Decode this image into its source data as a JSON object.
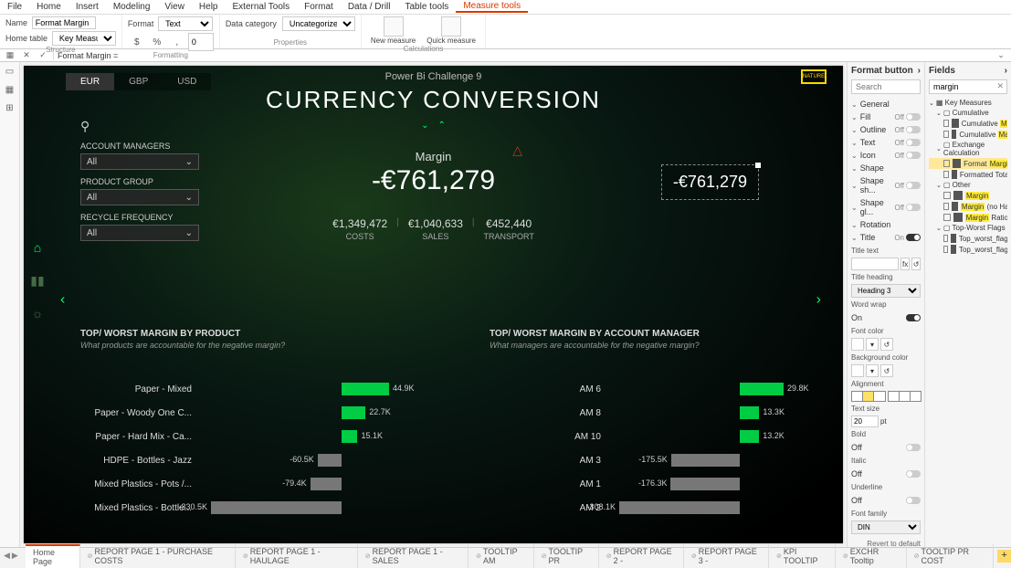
{
  "menu": {
    "items": [
      "File",
      "Home",
      "Insert",
      "Modeling",
      "View",
      "Help",
      "External Tools",
      "Format",
      "Data / Drill",
      "Table tools",
      "Measure tools"
    ],
    "active": 10
  },
  "ribbon": {
    "name_label": "Name",
    "name_value": "Format Margin",
    "home_table_label": "Home table",
    "home_table_value": "Key Measures",
    "structure": "Structure",
    "format_label": "Format",
    "format_value": "Text",
    "currency": "$",
    "percent": "%",
    "comma": ",",
    "decimals": "0",
    "formatting": "Formatting",
    "data_cat_label": "Data category",
    "data_cat_value": "Uncategorized",
    "properties": "Properties",
    "new_measure": "New\nmeasure",
    "quick_measure": "Quick\nmeasure",
    "calculations": "Calculations"
  },
  "fx": {
    "text": "Format Margin ="
  },
  "report": {
    "title_small": "Power Bi Challenge 9",
    "title": "CURRENCY CONVERSION",
    "currencies": [
      "EUR",
      "GBP",
      "USD"
    ],
    "currency_active": 0,
    "brand": "NATURE",
    "filters": {
      "account_managers": {
        "label": "ACCOUNT MANAGERS",
        "value": "All"
      },
      "product_group": {
        "label": "PRODUCT GROUP",
        "value": "All"
      },
      "recycle_frequency": {
        "label": "RECYCLE FREQUENCY",
        "value": "All"
      }
    },
    "metric": {
      "label": "Margin",
      "value": "-€761,279"
    },
    "card": {
      "value": "-€761,279"
    },
    "subs": [
      {
        "value": "€1,349,472",
        "label": "COSTS"
      },
      {
        "value": "€1,040,633",
        "label": "SALES"
      },
      {
        "value": "€452,440",
        "label": "TRANSPORT"
      }
    ],
    "sec_prod": {
      "title": "TOP/ WORST MARGIN BY PRODUCT",
      "sub": "What products are accountable for the negative margin?"
    },
    "sec_mgr": {
      "title": "TOP/ WORST MARGIN BY ACCOUNT MANAGER",
      "sub": "What managers are accountable for the negative margin?"
    }
  },
  "chart_data": [
    {
      "type": "bar",
      "orientation": "horizontal",
      "title": "TOP/ WORST MARGIN BY PRODUCT",
      "categories": [
        "Paper - Mixed",
        "Paper - Woody One C...",
        "Paper - Hard Mix - Ca...",
        "HDPE - Bottles - Jazz",
        "Mixed Plastics - Pots /...",
        "Mixed Plastics - Bottle..."
      ],
      "values": [
        44900,
        22700,
        15100,
        -60500,
        -79400,
        -330500
      ],
      "value_labels": [
        "44.9K",
        "22.7K",
        "15.1K",
        "-60.5K",
        "-79.4K",
        "-330.5K"
      ]
    },
    {
      "type": "bar",
      "orientation": "horizontal",
      "title": "TOP/ WORST MARGIN BY ACCOUNT MANAGER",
      "categories": [
        "AM 6",
        "AM 8",
        "AM 10",
        "AM 3",
        "AM 1",
        "AM 2"
      ],
      "values": [
        29800,
        13300,
        13200,
        -175500,
        -176300,
        -308100
      ],
      "value_labels": [
        "29.8K",
        "13.3K",
        "13.2K",
        "-175.5K",
        "-176.3K",
        "-308.1K"
      ]
    }
  ],
  "format_pane": {
    "title": "Format button",
    "search_ph": "Search",
    "rows": [
      {
        "name": "General"
      },
      {
        "name": "Fill",
        "state": "Off"
      },
      {
        "name": "Outline",
        "state": "Off"
      },
      {
        "name": "Text",
        "state": "Off"
      },
      {
        "name": "Icon",
        "state": "Off"
      },
      {
        "name": "Shape"
      },
      {
        "name": "Shape sh...",
        "state": "Off"
      },
      {
        "name": "Shape gl...",
        "state": "Off"
      },
      {
        "name": "Rotation"
      },
      {
        "name": "Title",
        "state": "On"
      }
    ],
    "title_text": "Title text",
    "title_text_hint": "fx",
    "title_heading": "Title heading",
    "title_heading_value": "Heading 3",
    "word_wrap": "Word wrap",
    "word_wrap_state": "On",
    "font_color": "Font color",
    "bg_color": "Background color",
    "alignment": "Alignment",
    "text_size": "Text size",
    "text_size_value": "20",
    "text_size_unit": "pt",
    "bold": "Bold",
    "bold_state": "Off",
    "italic": "Italic",
    "italic_state": "Off",
    "underline": "Underline",
    "underline_state": "Off",
    "font_family": "Font family",
    "font_family_value": "DIN",
    "revert": "Revert to default"
  },
  "fields_pane": {
    "title": "Fields",
    "search_value": "margin",
    "tables": [
      {
        "name": "Key Measures",
        "items": [
          {
            "group": "Cumulative",
            "items": [
              {
                "name": "Cumulative",
                "hl": "Margin"
              },
              {
                "name": "Cumulative",
                "hl": "Margin",
                "suffix": " Ratio"
              }
            ]
          },
          {
            "group": "Exchange Calculation",
            "items": [
              {
                "name": "Format",
                "hl": "Margin",
                "sel": true
              },
              {
                "name": "Formatted Total",
                "hl": "Margin"
              }
            ]
          },
          {
            "group": "Other",
            "items": [
              {
                "name": "",
                "hl": "Margin"
              },
              {
                "name": "",
                "hl": "Margin",
                "suffix": " (no Haulage)"
              },
              {
                "name": "",
                "hl": "Margin",
                "suffix": " Ratio"
              }
            ]
          },
          {
            "group": "Top-Worst Flags",
            "items": [
              {
                "name": "Top_worst_flag AM",
                "hl": "Margin"
              },
              {
                "name": "Top_worst_flag Product",
                "hl": "M"
              }
            ]
          }
        ]
      }
    ]
  },
  "page_tabs": {
    "tabs": [
      {
        "name": "Home Page",
        "hidden": false,
        "active": true
      },
      {
        "name": "REPORT PAGE 1 - PURCHASE COSTS",
        "hidden": true
      },
      {
        "name": "REPORT PAGE 1 - HAULAGE",
        "hidden": true
      },
      {
        "name": "REPORT PAGE 1 - SALES",
        "hidden": true
      },
      {
        "name": "TOOLTIP AM",
        "hidden": true
      },
      {
        "name": "TOOLTIP PR",
        "hidden": true
      },
      {
        "name": "REPORT PAGE 2 -",
        "hidden": true
      },
      {
        "name": "REPORT PAGE 3 -",
        "hidden": true
      },
      {
        "name": "KPI TOOLTIP",
        "hidden": true
      },
      {
        "name": "EXCHR Tooltip",
        "hidden": true
      },
      {
        "name": "TOOLTIP PR COST",
        "hidden": true
      }
    ]
  }
}
